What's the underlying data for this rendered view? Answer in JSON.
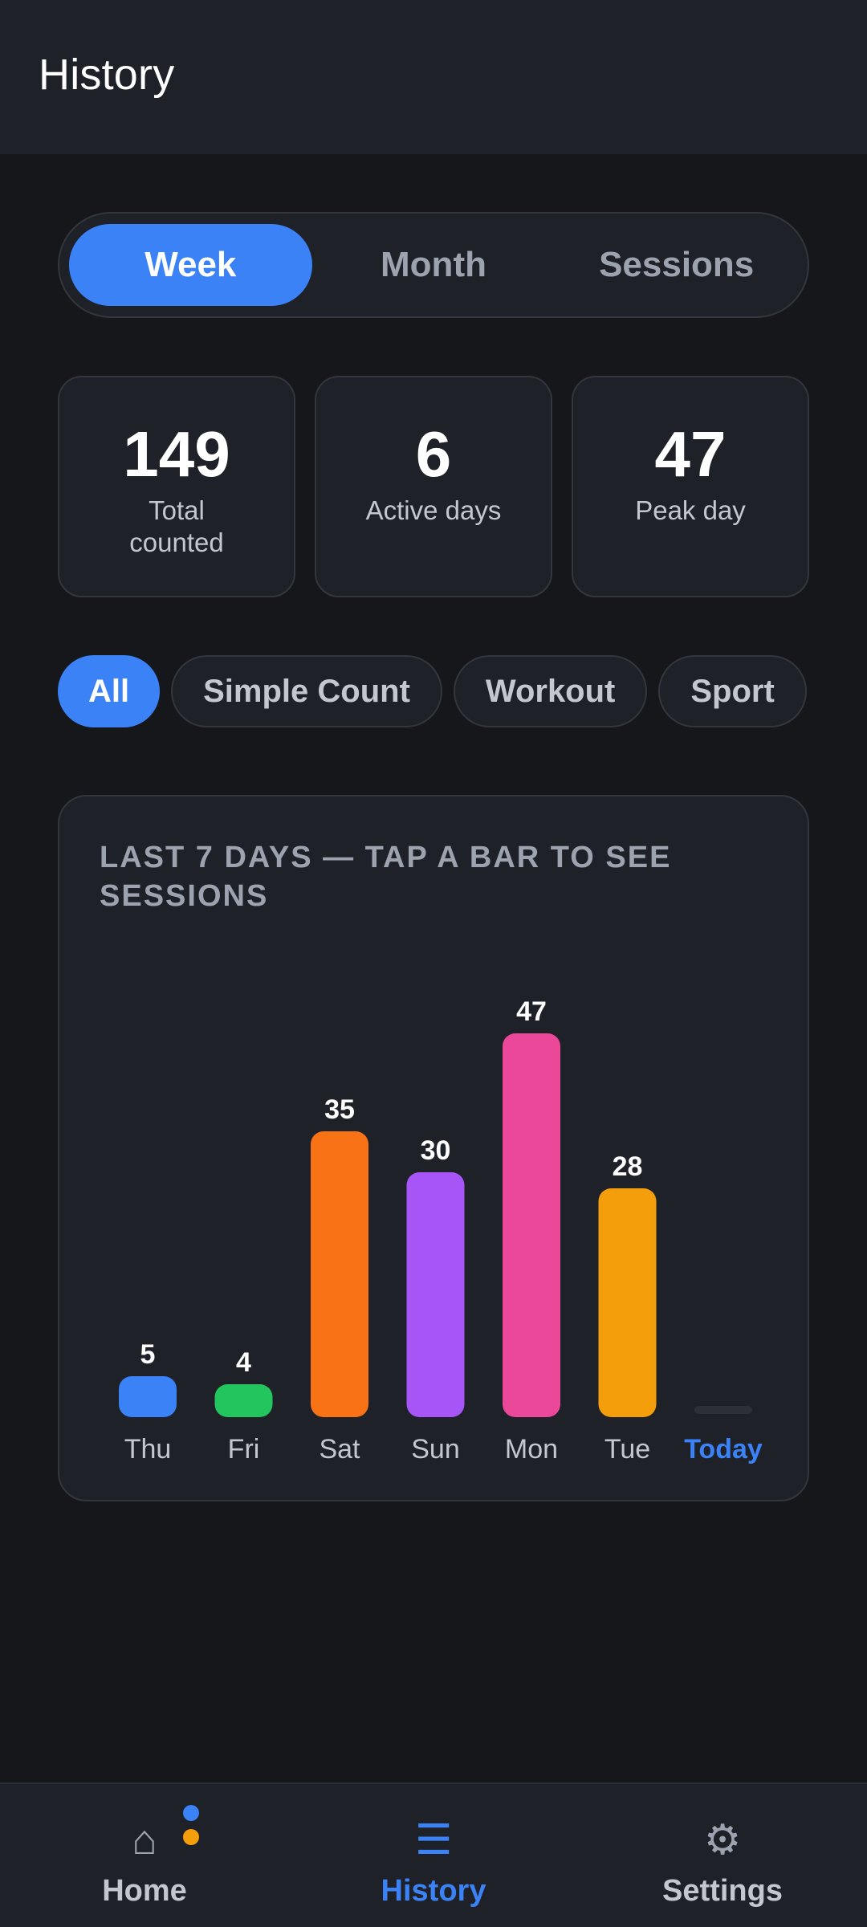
{
  "header": {
    "title": "History"
  },
  "tabs": [
    {
      "label": "Week",
      "active": true
    },
    {
      "label": "Month",
      "active": false
    },
    {
      "label": "Sessions",
      "active": false
    }
  ],
  "stats": [
    {
      "value": "149",
      "label": "Total counted"
    },
    {
      "value": "6",
      "label": "Active days"
    },
    {
      "value": "47",
      "label": "Peak day"
    }
  ],
  "filters": [
    {
      "label": "All",
      "active": true
    },
    {
      "label": "Simple Count",
      "active": false
    },
    {
      "label": "Workout",
      "active": false
    },
    {
      "label": "Sport",
      "active": false
    },
    {
      "label": "",
      "active": false
    }
  ],
  "chart_data": {
    "type": "bar",
    "title": "LAST 7 DAYS — TAP A BAR TO SEE SESSIONS",
    "categories": [
      "Thu",
      "Fri",
      "Sat",
      "Sun",
      "Mon",
      "Tue",
      "Today"
    ],
    "values": [
      5,
      4,
      35,
      30,
      47,
      28,
      0
    ],
    "value_labels": [
      "5",
      "4",
      "35",
      "30",
      "47",
      "28",
      ""
    ],
    "colors": [
      "#3b82f6",
      "#22c55e",
      "#f97316",
      "#a855f7",
      "#ec4899",
      "#f59e0b",
      "#2c2f36"
    ],
    "highlight_category": "Today",
    "highlight_color": "#3b82f6",
    "ylim": [
      0,
      47
    ]
  },
  "nav": [
    {
      "label": "Home",
      "icon": "home-icon",
      "glyph": "⌂",
      "active": false
    },
    {
      "label": "History",
      "icon": "list-icon",
      "glyph": "☰",
      "active": true
    },
    {
      "label": "Settings",
      "icon": "gear-icon",
      "glyph": "⚙",
      "active": false
    }
  ],
  "nav_badges": {
    "colors": [
      "#3b82f6",
      "#f59e0b"
    ]
  }
}
